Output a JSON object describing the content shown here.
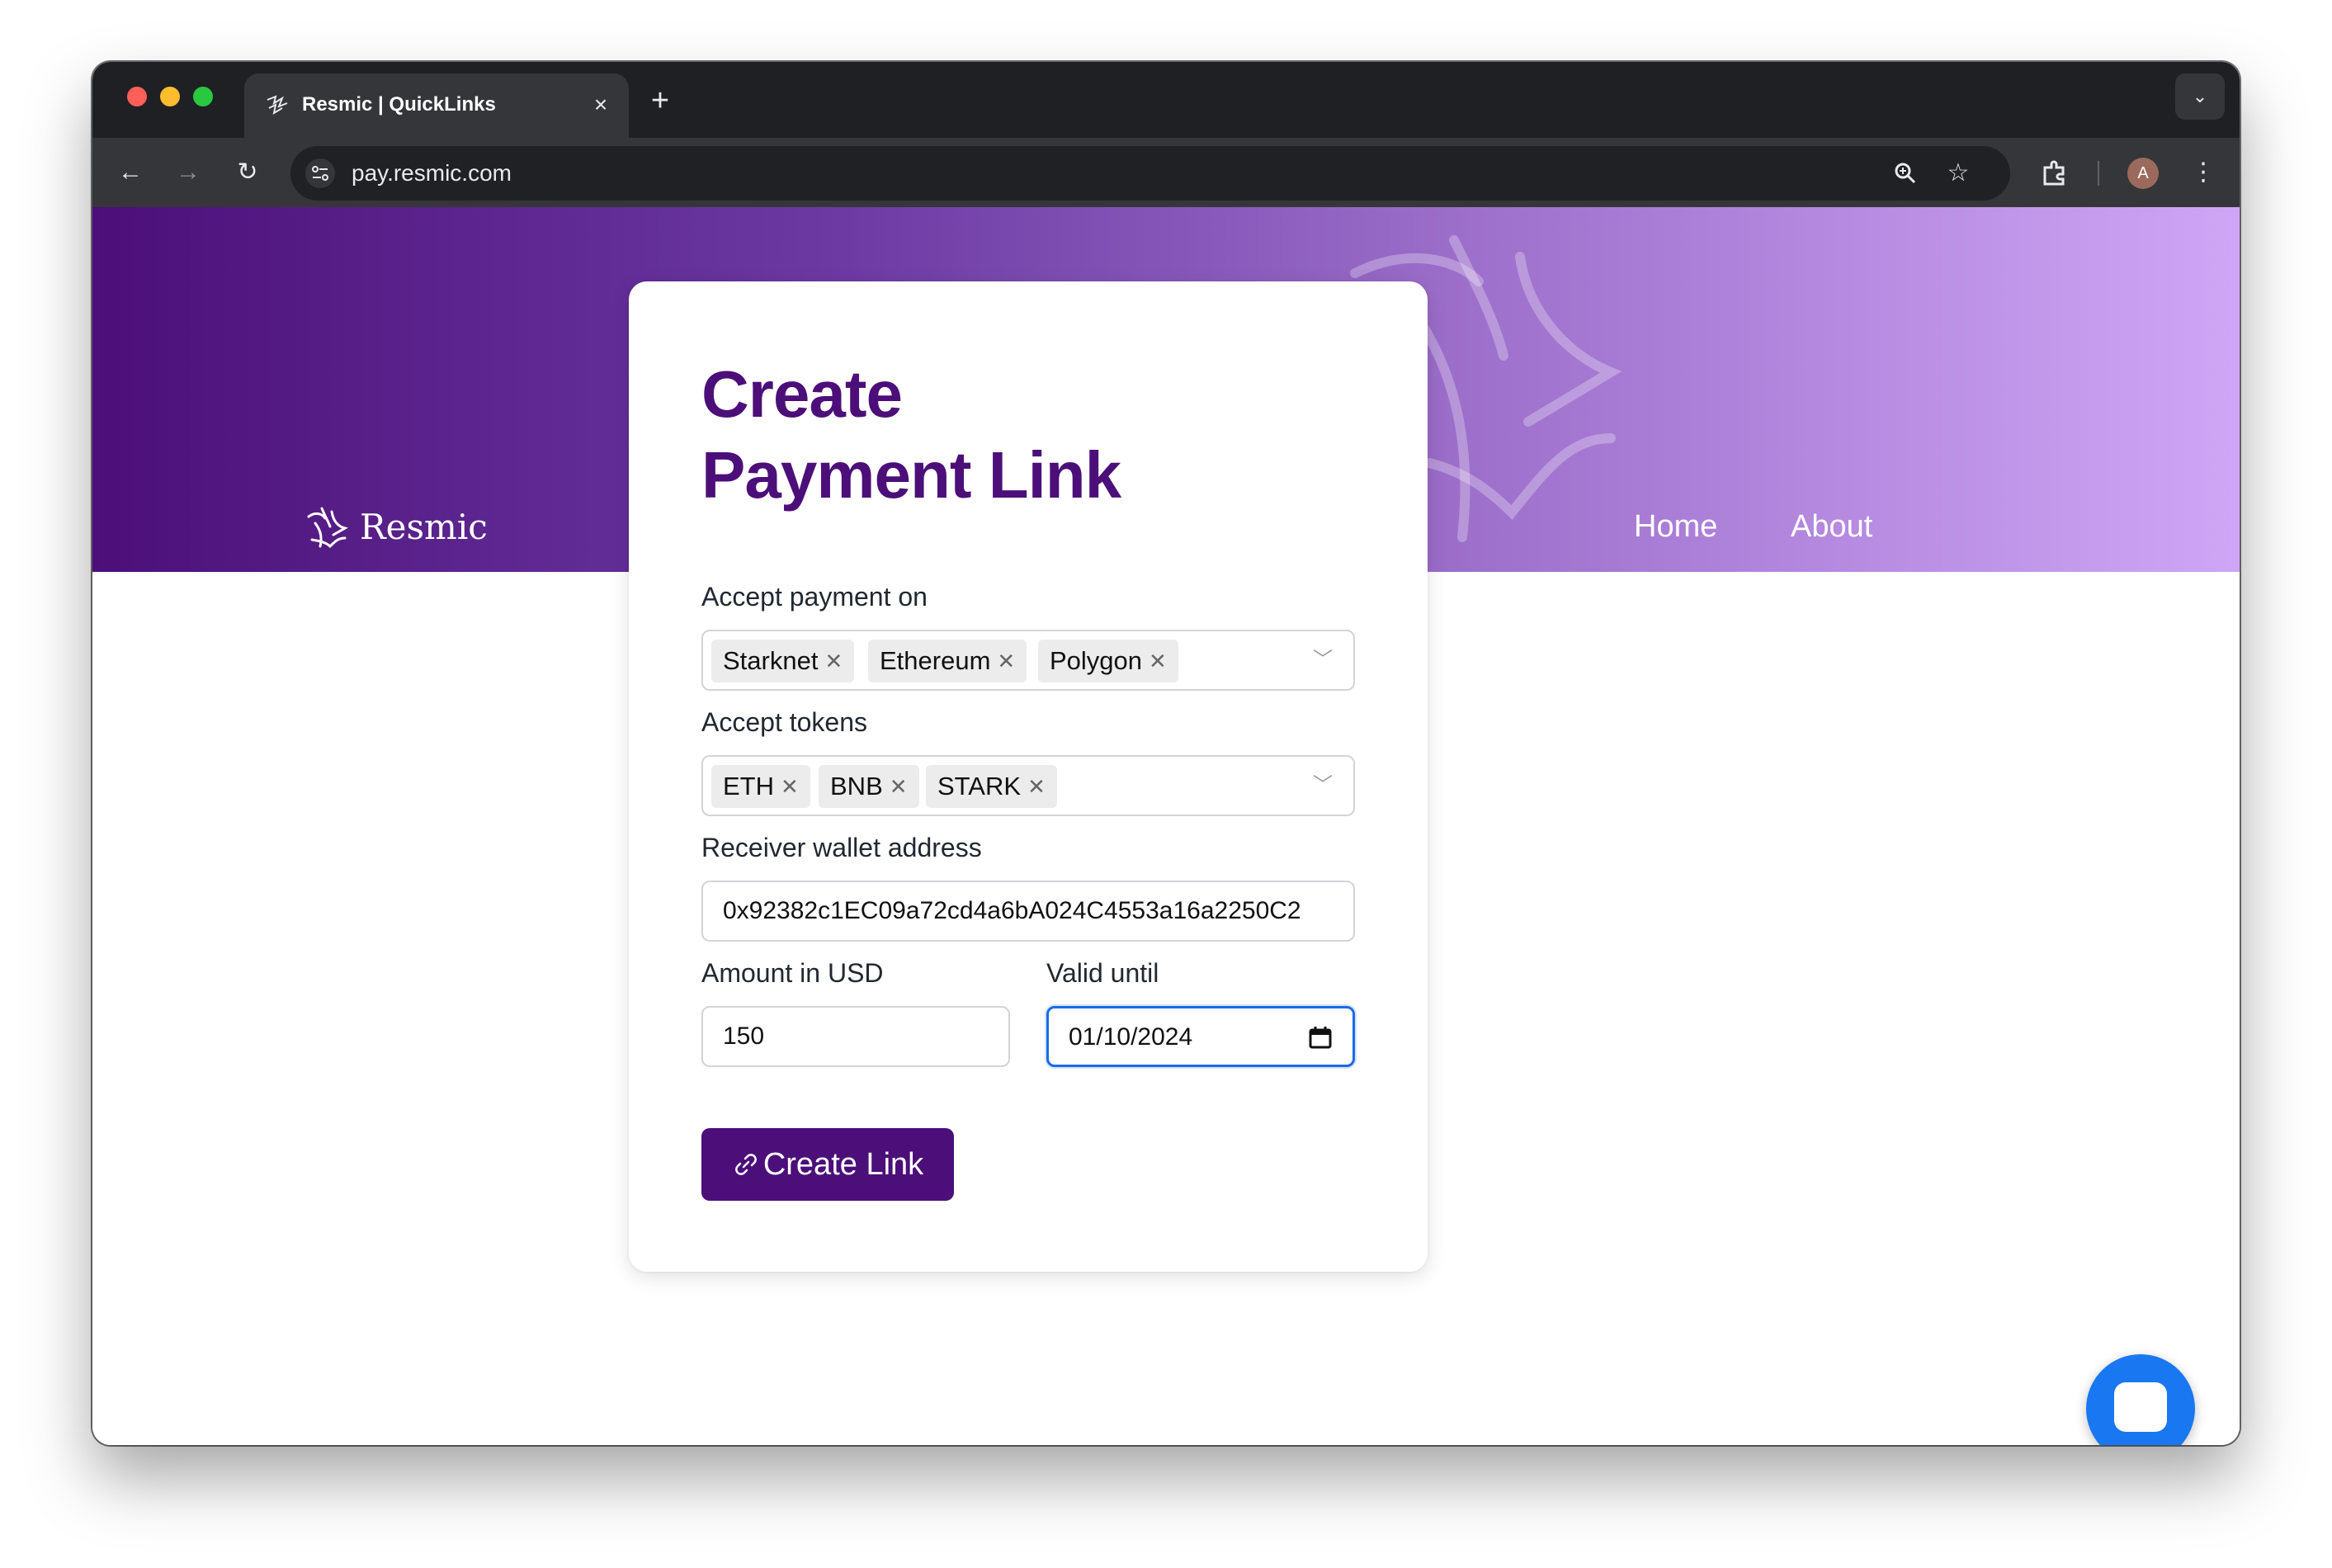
{
  "browser": {
    "tab_title": "Resmic | QuickLinks",
    "url": "pay.resmic.com",
    "profile_initial": "A"
  },
  "site": {
    "brand": "Resmic",
    "nav": {
      "home": "Home",
      "about": "About"
    }
  },
  "form": {
    "title_line1": "Create",
    "title_line2": "Payment Link",
    "networks_label": "Accept payment on",
    "networks": [
      "Starknet",
      "Ethereum",
      "Polygon"
    ],
    "tokens_label": "Accept tokens",
    "tokens": [
      "ETH",
      "BNB",
      "STARK"
    ],
    "wallet_label": "Receiver wallet address",
    "wallet_value": "0x92382c1EC09a72cd4a6bA024C4553a16a2250C2",
    "amount_label": "Amount in USD",
    "amount_value": "150",
    "valid_label": "Valid until",
    "valid_value": "01/10/2024",
    "submit_label": "Create Link"
  },
  "colors": {
    "brand_purple": "#4c0f79",
    "focus_blue": "#1a6ce8",
    "chat_blue": "#1a77f2"
  },
  "icons": {
    "chat": "chat-bubble-icon",
    "link": "link-icon",
    "calendar": "calendar-icon"
  }
}
